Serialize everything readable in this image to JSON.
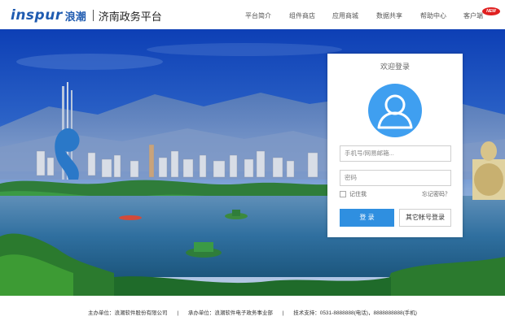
{
  "header": {
    "logo_latin": "inspur",
    "logo_cn": "浪潮",
    "site_title": "济南政务平台",
    "nav": [
      "平台简介",
      "组件商店",
      "应用商城",
      "数据共享",
      "帮助中心",
      "客户端"
    ],
    "new_badge": "NEW"
  },
  "login": {
    "title": "欢迎登录",
    "username_placeholder": "手机号/网易邮箱...",
    "password_placeholder": "密码",
    "remember_label": "记住我",
    "forgot_label": "忘记密码？",
    "login_button": "登 录",
    "other_account_button": "其它帐号登录"
  },
  "footer": {
    "items": [
      "主办单位：浪潮软件股份有限公司",
      "|",
      "承办单位：浪潮软件电子政务事业部",
      "|",
      "技术支持：0531-8888888(电话)，8888888888(手机)"
    ]
  },
  "colors": {
    "brand_blue": "#1f5bb0",
    "login_button": "#2f8fe0",
    "avatar": "#3f9ff0",
    "badge_red": "#e02020"
  }
}
